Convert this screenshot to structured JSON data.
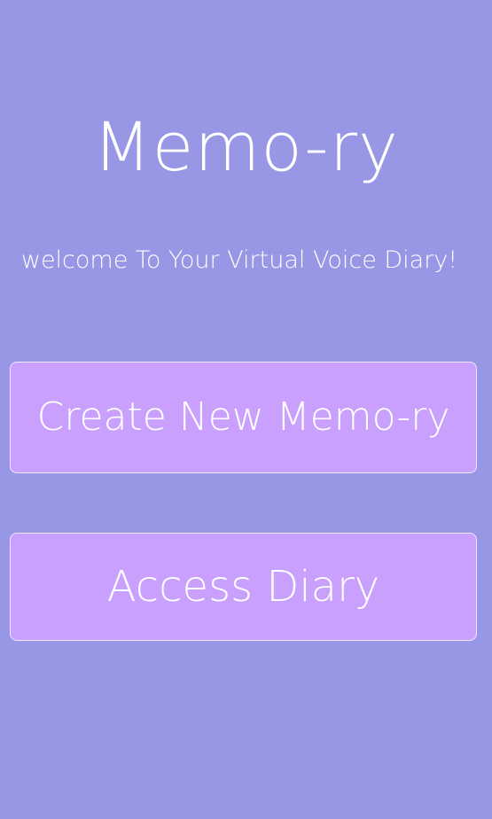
{
  "app": {
    "title": "Memo-ry",
    "subtitle": "welcome To Your Virtual Voice Diary!"
  },
  "actions": {
    "create_label": "Create New Memo-ry",
    "access_label": "Access Diary"
  },
  "colors": {
    "background": "#9797e6",
    "button_fill": "#c9a0fe",
    "button_border": "#f1e6ff",
    "text": "#ffffff"
  }
}
